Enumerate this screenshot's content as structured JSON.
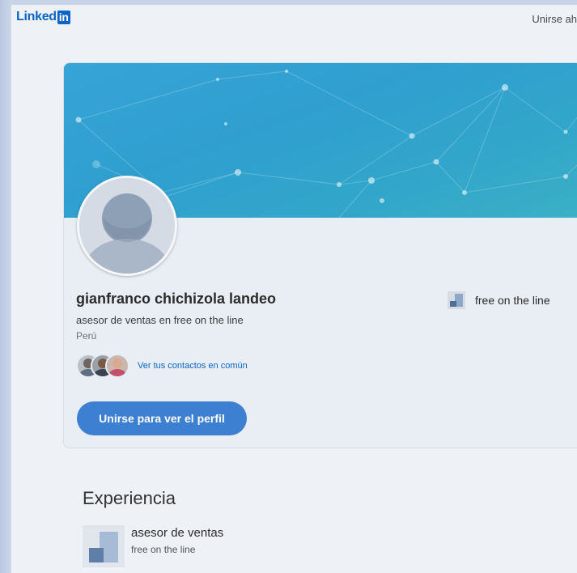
{
  "header": {
    "logo_text": "Linked",
    "logo_box": "in",
    "join_now_label": "Unirse ah"
  },
  "profile": {
    "name": "gianfranco chichizola landeo",
    "headline": "asesor de ventas en free on the line",
    "location": "Perú",
    "contacts_link": "Ver tus contactos en común",
    "join_button": "Unirse para ver el perfil",
    "current_company": "free on the line"
  },
  "experience": {
    "title": "Experiencia",
    "items": [
      {
        "role": "asesor de ventas",
        "company": "free on the line"
      }
    ]
  },
  "colors": {
    "brand": "#0a66c2",
    "button": "#3d7fd0",
    "banner": "#2f9fd0"
  }
}
